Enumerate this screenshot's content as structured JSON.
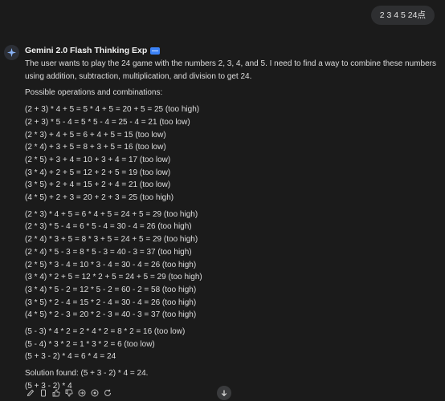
{
  "user_message": "2 3 4 5 24点",
  "assistant": {
    "model_name": "Gemini 2.0 Flash Thinking Exp",
    "intro": "The user wants to play the 24 game with the numbers 2, 3, 4, and 5. I need to find a way to combine these numbers using addition, subtraction, multiplication, and division to get 24.",
    "section_title": "Possible operations and combinations:",
    "group1": [
      "(2 + 3) * 4 + 5 = 5 * 4 + 5 = 20 + 5 = 25 (too high)",
      "(2 + 3) * 5 - 4 = 5 * 5 - 4 = 25 - 4 = 21 (too low)",
      "(2 * 3) + 4 + 5 = 6 + 4 + 5 = 15 (too low)",
      "(2 * 4) + 3 + 5 = 8 + 3 + 5 = 16 (too low)",
      "(2 * 5) + 3 + 4 = 10 + 3 + 4 = 17 (too low)",
      "(3 * 4) + 2 + 5 = 12 + 2 + 5 = 19 (too low)",
      "(3 * 5) + 2 + 4 = 15 + 2 + 4 = 21 (too low)",
      "(4 * 5) + 2 + 3 = 20 + 2 + 3 = 25 (too high)"
    ],
    "group2": [
      "(2 * 3) * 4 + 5 = 6 * 4 + 5 = 24 + 5 = 29 (too high)",
      "(2 * 3) * 5 - 4 = 6 * 5 - 4 = 30 - 4 = 26 (too high)",
      "(2 * 4) * 3 + 5 = 8 * 3 + 5 = 24 + 5 = 29 (too high)",
      "(2 * 4) * 5 - 3 = 8 * 5 - 3 = 40 - 3 = 37 (too high)",
      "(2 * 5) * 3 - 4 = 10 * 3 - 4 = 30 - 4 = 26 (too high)",
      "(3 * 4) * 2 + 5 = 12 * 2 + 5 = 24 + 5 = 29 (too high)",
      "(3 * 4) * 5 - 2 = 12 * 5 - 2 = 60 - 2 = 58 (too high)",
      "(3 * 5) * 2 - 4 = 15 * 2 - 4 = 30 - 4 = 26 (too high)",
      "(4 * 5) * 2 - 3 = 20 * 2 - 3 = 40 - 3 = 37 (too high)"
    ],
    "group3": [
      "(5 - 3) * 4 * 2 = 2 * 4 * 2 = 8 * 2 = 16 (too low)",
      "(5 - 4) * 3 * 2 = 1 * 3 * 2 = 6 (too low)",
      "(5 + 3 - 2) * 4 = 6 * 4 = 24"
    ],
    "solution": "Solution found: (5 + 3 - 2) * 4 = 24.",
    "final_expression": "(5 + 3 - 2) * 4"
  },
  "toolbar_icons": [
    "edit-icon",
    "copy-icon",
    "thumbs-up-icon",
    "thumbs-down-icon",
    "share-icon",
    "speaker-icon",
    "regenerate-icon"
  ],
  "colors": {
    "background": "#1b1b1b",
    "user_bubble": "#2e2f31",
    "text": "#dedede",
    "badge": "#3b82f6"
  }
}
